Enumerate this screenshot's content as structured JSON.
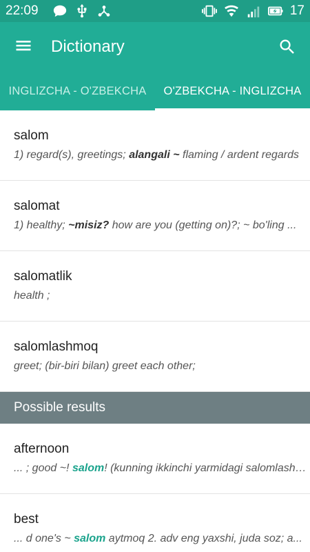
{
  "status": {
    "time": "22:09",
    "battery_level": "17",
    "icons": [
      "chat-icon",
      "usb-icon",
      "share-icon",
      "vibrate-icon",
      "wifi-icon",
      "signal-4g-icon",
      "battery-charging-icon"
    ]
  },
  "appbar": {
    "title": "Dictionary",
    "menu_icon": "menu-icon",
    "search_icon": "search-icon"
  },
  "tabs": [
    {
      "label": "INGLIZCHA - O'ZBEKCHA",
      "active": false
    },
    {
      "label": "O'ZBEKCHA - INGLIZCHA",
      "active": true
    }
  ],
  "entries": [
    {
      "word": "salom",
      "def_pre": "1) regard(s), greetings; ",
      "def_bold": "alangali ~",
      "def_post": " flaming / ardent regards"
    },
    {
      "word": "salomat",
      "def_pre": "1) healthy; ",
      "def_bold": "~misiz?",
      "def_post": " how are you (getting on)?; ~ bo'ling ..."
    },
    {
      "word": "salomatlik",
      "def_pre": "health ;",
      "def_bold": "",
      "def_post": ""
    },
    {
      "word": "salomlashmoq",
      "def_pre": "greet; (bir-biri bilan) greet each other;",
      "def_bold": "",
      "def_post": ""
    }
  ],
  "section": {
    "label": "Possible results"
  },
  "possible": [
    {
      "word": "afternoon",
      "def_pre": "... ; good ~! ",
      "def_hl": "salom",
      "def_post": "! (kunning ikkinchi yarmidagi salomlashuv)"
    },
    {
      "word": "best",
      "def_pre": "... d one's ~ ",
      "def_hl": "salom",
      "def_post": " aytmoq  2. adv eng yaxshi, juda soz; a..."
    }
  ],
  "colors": {
    "statusbar": "#1f9e87",
    "primary": "#21ad96",
    "section": "#6e7f83",
    "highlight": "#1aa38c"
  }
}
